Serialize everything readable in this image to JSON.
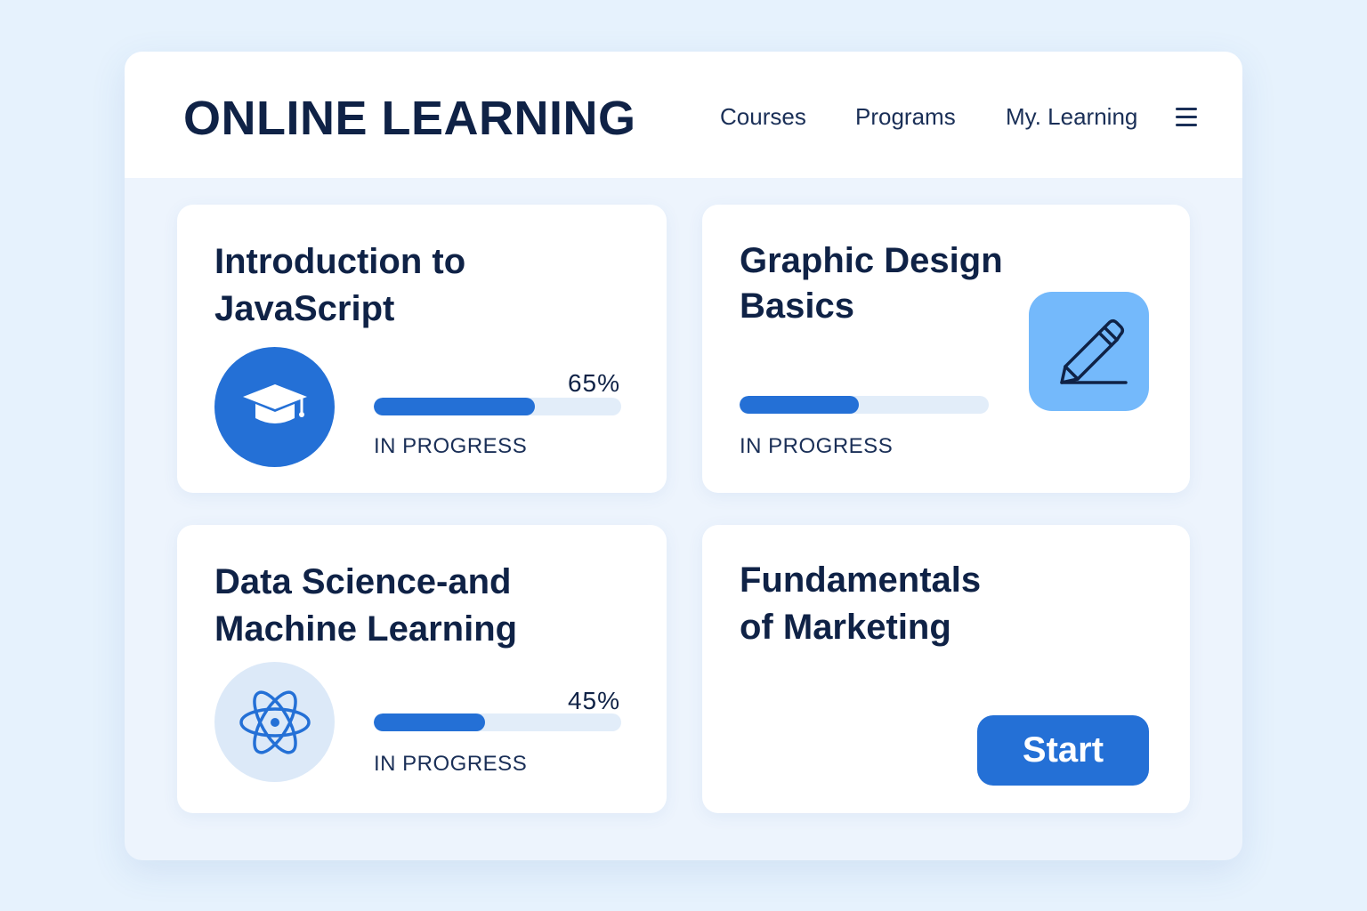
{
  "header": {
    "brand": "ONLINE LEARNING",
    "nav": {
      "courses": "Courses",
      "programs": "Programs",
      "my_learning": "My. Learning"
    },
    "menu_icon": "hamburger-menu-icon"
  },
  "courses": [
    {
      "title_line1": "Introduction to",
      "title_line2": "JavaScript",
      "progress": 0.65,
      "progress_label": "65%",
      "status": "IN PROGRESS",
      "icon": "graduation-cap-icon"
    },
    {
      "title_line1": "Graphic Design",
      "title_line2": "Basics",
      "progress": 0.48,
      "status": "IN PROGRESS",
      "icon": "pencil-icon"
    },
    {
      "title_line1": "Data Science-and",
      "title_line2": "Machine Learning",
      "progress": 0.45,
      "progress_label": "45%",
      "status": "IN PROGRESS",
      "icon": "atom-icon"
    },
    {
      "title_line1": "Fundamentals",
      "title_line2": "of Marketing",
      "action_label": "Start"
    }
  ],
  "colors": {
    "accent": "#2470d6",
    "text": "#0f2246",
    "page_bg": "#e6f2fd",
    "track": "#e2edf9",
    "pencil_tile": "#74b9fb"
  }
}
